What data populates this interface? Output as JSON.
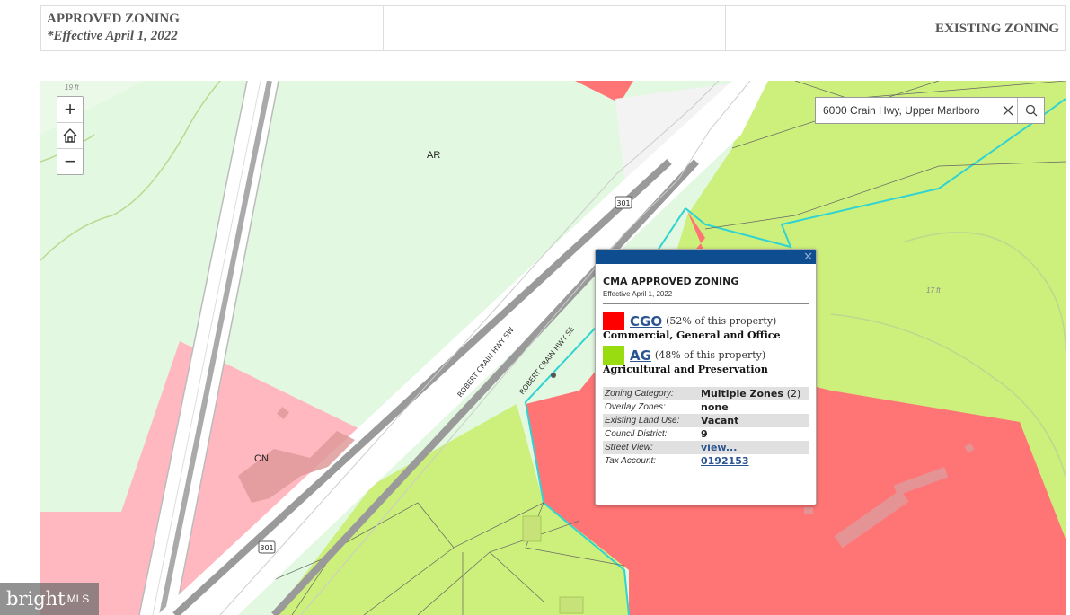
{
  "header": {
    "approved_title": "APPROVED ZONING",
    "approved_effective": "*Effective April 1, 2022",
    "existing_title": "EXISTING ZONING"
  },
  "map": {
    "zoom_in": "+",
    "home_icon": "home-icon",
    "zoom_out": "−",
    "search": {
      "value": "6000 Crain Hwy, Upper Marlboro",
      "clear_icon": "close-icon",
      "search_icon": "search-icon"
    },
    "labels": {
      "ar": "AR",
      "cn": "CN"
    },
    "elevations": {
      "top_left": "19 ft",
      "right": "17 ft"
    },
    "roads": {
      "sw": "ROBERT CRAIN HWY SW",
      "se": "ROBERT CRAIN HWY SE"
    },
    "shields": {
      "top": "301",
      "bottom": "301"
    },
    "colors": {
      "cgo": "#ff0000",
      "ag": "#99dd11",
      "ar": "#e2f8e0",
      "cn": "#ffb8bf",
      "parcel_outline": "#2fd3d3"
    }
  },
  "popup": {
    "title": "CMA APPROVED ZONING",
    "subtitle": "Effective April 1, 2022",
    "close_icon": "close-icon",
    "zones": [
      {
        "code": "CGO",
        "pct": "(52% of this property)",
        "name": "Commercial, General and Office",
        "color": "#ff0000"
      },
      {
        "code": "AG",
        "pct": "(48% of this property)",
        "name": "Agricultural and Preservation",
        "color": "#99dd11"
      }
    ],
    "attributes": [
      {
        "key": "Zoning Category:",
        "value": "Multiple Zones",
        "extra": "(2)"
      },
      {
        "key": "Overlay Zones:",
        "value": "none"
      },
      {
        "key": "Existing Land Use:",
        "value": "Vacant"
      },
      {
        "key": "Council District:",
        "value": "9"
      },
      {
        "key": "Street View:",
        "value": "view..."
      },
      {
        "key": "Tax Account:",
        "value": "0192153"
      }
    ]
  },
  "watermark": {
    "brand": "bright",
    "suffix": "MLS"
  }
}
